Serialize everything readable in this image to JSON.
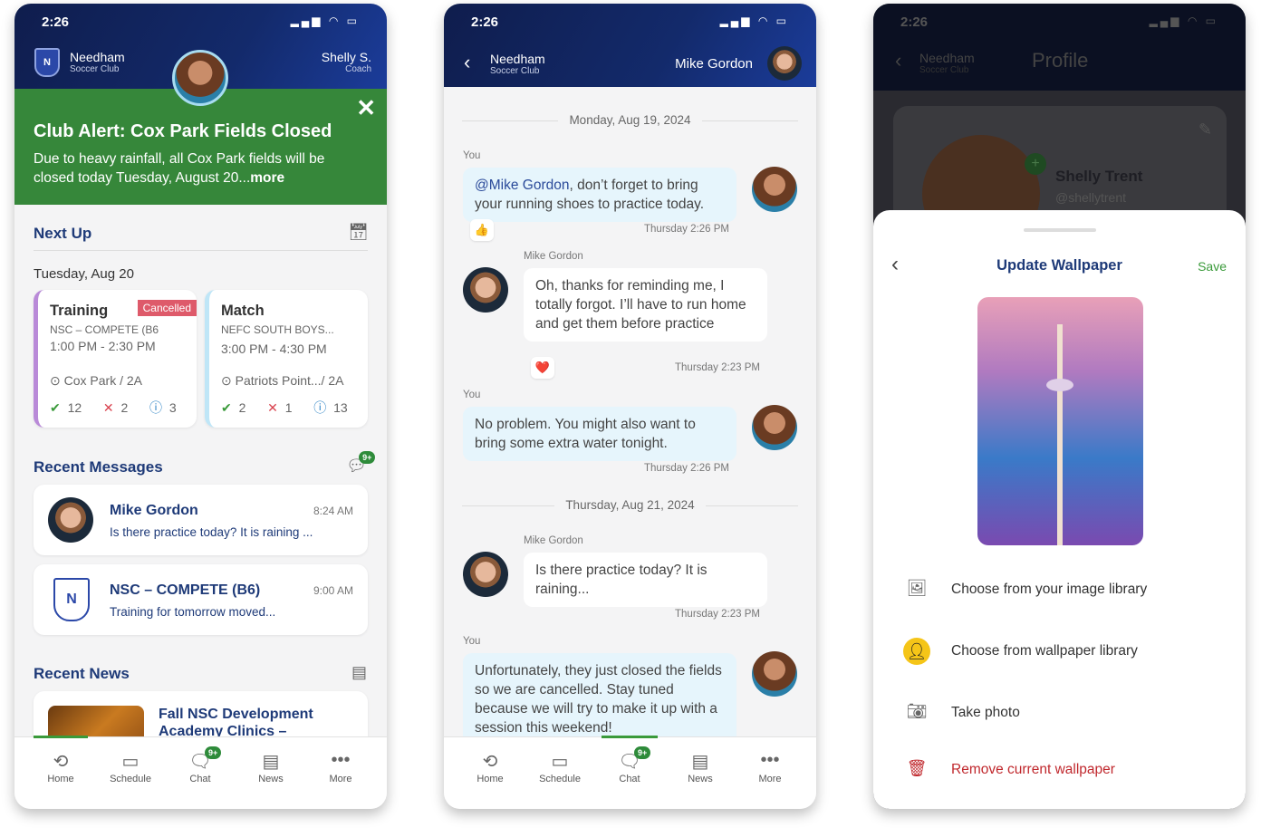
{
  "status_time": "2:26",
  "club": {
    "name": "Needham",
    "sub": "Soccer Club"
  },
  "home": {
    "user": {
      "name": "Shelly S.",
      "role": "Coach"
    },
    "alert": {
      "title": "Club Alert: Cox Park Fields Closed",
      "body": "Due to heavy rainfall, all Cox Park fields will be closed today Tuesday, August 20...",
      "more": "more"
    },
    "next_up": {
      "title": "Next Up",
      "date": "Tuesday, Aug 20",
      "events": [
        {
          "title": "Training",
          "badge": "Cancelled",
          "team": "NSC – COMPETE (B6",
          "time": "1:00 PM - 2:30 PM",
          "location": "Cox Park / 2A",
          "yes": "12",
          "no": "2",
          "info": "3",
          "accent": "#b98ad8"
        },
        {
          "title": "Match",
          "badge": "",
          "team": "NEFC SOUTH BOYS...",
          "time": "3:00 PM - 4:30 PM",
          "location": "Patriots Point.../ 2A",
          "yes": "2",
          "no": "1",
          "info": "13",
          "accent": "#bfe6f7"
        }
      ]
    },
    "recent_messages": {
      "title": "Recent Messages",
      "badge": "9+",
      "items": [
        {
          "name": "Mike Gordon",
          "time": "8:24 AM",
          "preview": "Is there practice today? It is raining ..."
        },
        {
          "name": "NSC – COMPETE (B6)",
          "time": "9:00 AM",
          "preview": "Training for tomorrow moved..."
        }
      ]
    },
    "recent_news": {
      "title": "Recent News",
      "items": [
        {
          "title": "Fall NSC Development Academy Clinics –"
        }
      ]
    }
  },
  "nav": {
    "items": [
      "Home",
      "Schedule",
      "Chat",
      "News",
      "More"
    ],
    "chat_badge": "9+"
  },
  "chat": {
    "contact": "Mike Gordon",
    "date1": "Monday, Aug 19, 2024",
    "date2": "Thursday, Aug 21, 2024",
    "you": "You",
    "messages": [
      {
        "sender": "You",
        "mention": "@Mike Gordon",
        "text": ", don’t forget to bring your running shoes to practice today.",
        "time": "Thursday 2:26 PM",
        "reaction": "👍"
      },
      {
        "sender": "Mike Gordon",
        "text": "Oh, thanks for reminding me, I totally forgot. I’ll have to run home and get them before practice",
        "time": "Thursday 2:23 PM",
        "reaction": "❤️"
      },
      {
        "sender": "You",
        "text": "No problem. You might also want to bring some extra water tonight.",
        "time": "Thursday 2:26 PM"
      },
      {
        "sender": "Mike Gordon",
        "text": "Is there practice today? It is raining...",
        "time": "Thursday 2:23 PM"
      },
      {
        "sender": "You",
        "text": "Unfortunately, they just closed the fields so we are cancelled. Stay tuned because we will try to make it up with a session this weekend!"
      }
    ]
  },
  "profile": {
    "title": "Profile",
    "name": "Shelly Trent",
    "handle": "@shellytrent",
    "sheet": {
      "title": "Update Wallpaper",
      "save": "Save",
      "options": [
        "Choose from your image library",
        "Choose from wallpaper library",
        "Take photo",
        "Remove current wallpaper"
      ]
    }
  },
  "colors": {
    "navy": "#132a6b",
    "green": "#3a8a3a",
    "alert_green": "#36873a",
    "danger": "#c0282d",
    "cancel_badge": "#de5a6a"
  }
}
